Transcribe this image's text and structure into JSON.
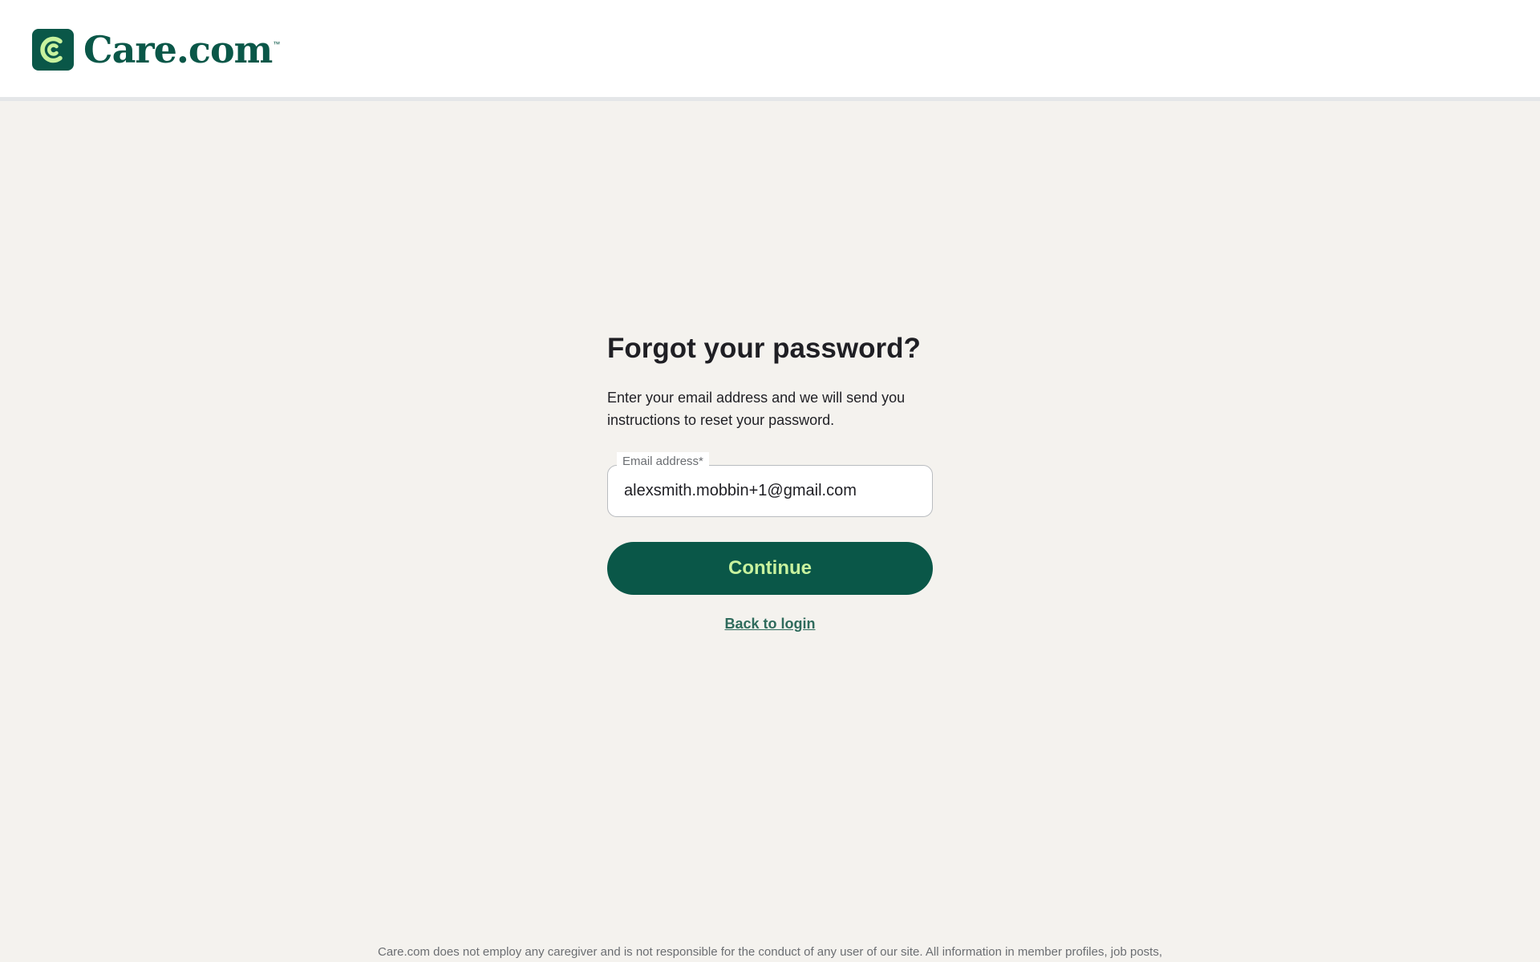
{
  "header": {
    "logo": {
      "icon": "care-logo-icon",
      "text": "Care.com",
      "trademark": "™"
    }
  },
  "form": {
    "title": "Forgot your password?",
    "description": "Enter your email address and we will send you instructions to reset your password.",
    "email_label": "Email address*",
    "email_value": "alexsmith.mobbin+1@gmail.com",
    "continue_label": "Continue",
    "back_link_label": "Back to login"
  },
  "footer": {
    "disclaimer": "Care.com does not employ any caregiver and is not responsible for the conduct of any user of our site. All information in member profiles, job posts,"
  },
  "colors": {
    "brand_green": "#0a5748",
    "button_text": "#c8f29e",
    "page_background": "#f4f2ee"
  }
}
